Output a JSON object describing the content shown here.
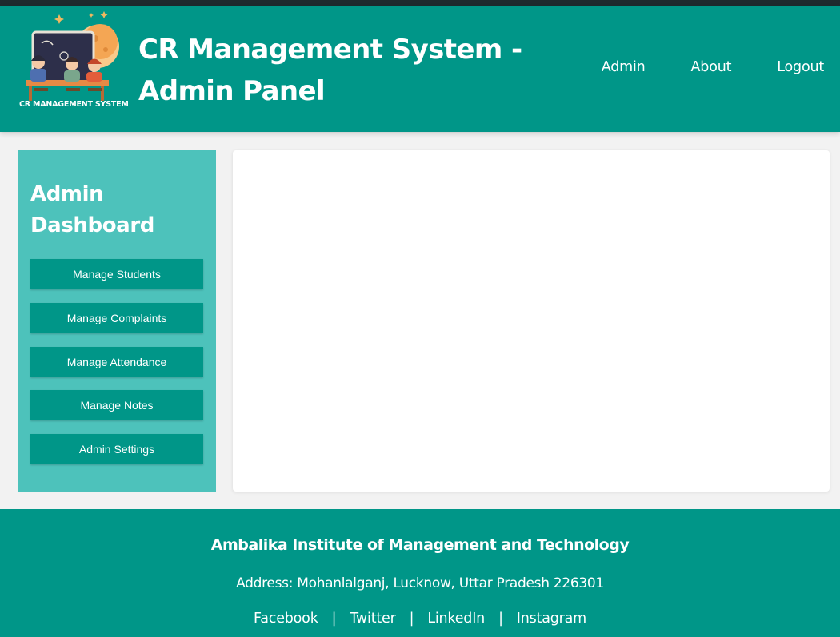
{
  "header": {
    "logo_caption": "CR MANAGEMENT SYSTEM",
    "title": "CR Management System - Admin Panel",
    "nav": [
      {
        "label": "Admin"
      },
      {
        "label": "About"
      },
      {
        "label": "Logout"
      }
    ]
  },
  "sidebar": {
    "title": "Admin Dashboard",
    "buttons": [
      {
        "label": "Manage Students"
      },
      {
        "label": "Manage Complaints"
      },
      {
        "label": "Manage Attendance"
      },
      {
        "label": "Manage Notes"
      },
      {
        "label": "Admin Settings"
      }
    ]
  },
  "footer": {
    "institution": "Ambalika Institute of Management and Technology",
    "address": "Address: Mohanlalganj, Lucknow, Uttar Pradesh 226301",
    "links": [
      {
        "label": "Facebook"
      },
      {
        "label": "Twitter"
      },
      {
        "label": "LinkedIn"
      },
      {
        "label": "Instagram"
      }
    ],
    "separator": "|"
  },
  "colors": {
    "primary": "#009688",
    "sidebar": "#4dc2bb",
    "background": "#f2f2f2",
    "topline": "#1e2a2e"
  },
  "icons": {
    "logo": "students-at-desk-illustration"
  }
}
